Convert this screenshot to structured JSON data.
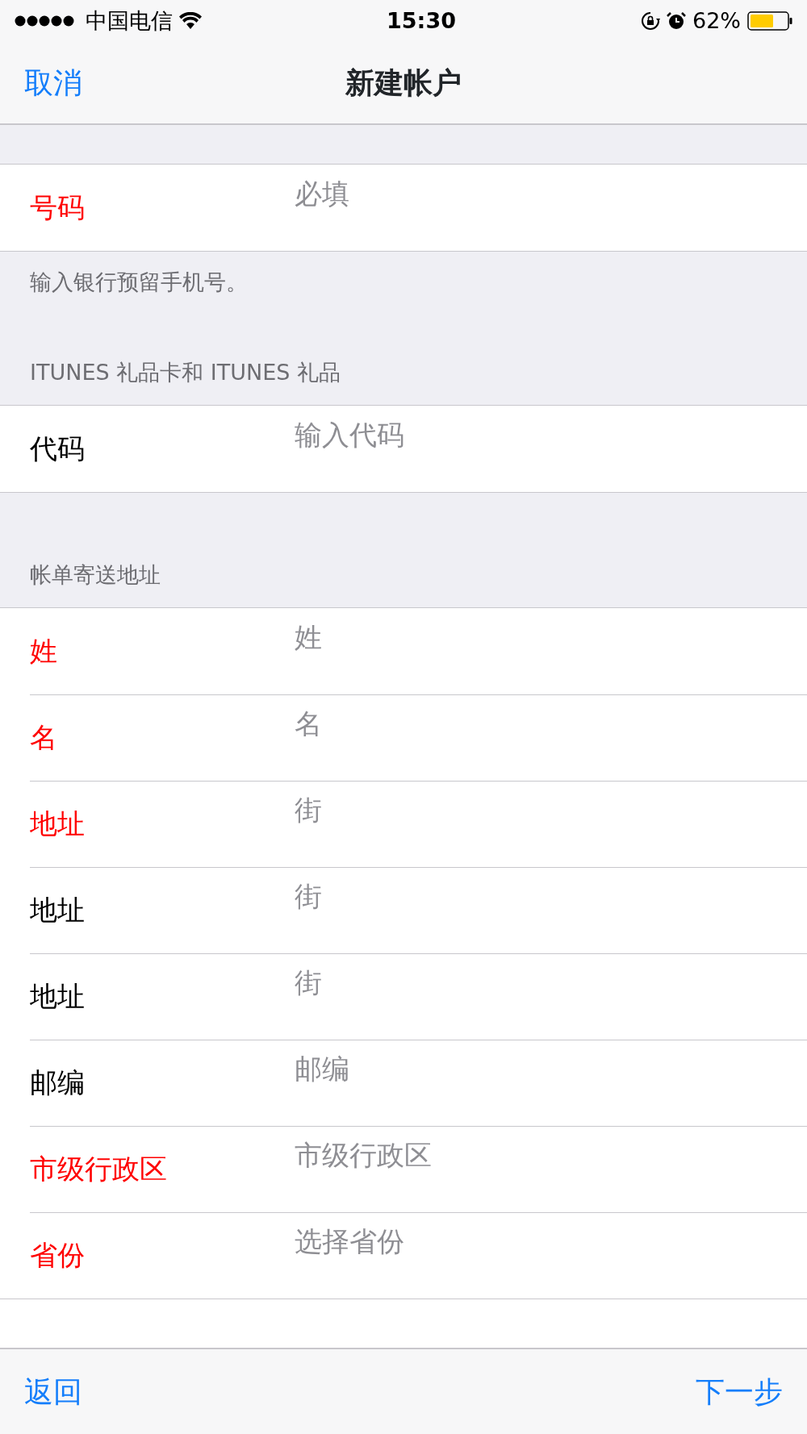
{
  "status_bar": {
    "carrier": "中国电信",
    "time": "15:30",
    "battery": "62%"
  },
  "nav": {
    "cancel": "取消",
    "title": "新建帐户"
  },
  "sections": [
    {
      "rows": [
        {
          "label": "号码",
          "placeholder": "必填",
          "required": true
        }
      ],
      "footer": "输入银行预留手机号。"
    },
    {
      "header": "ITUNES 礼品卡和 ITUNES 礼品",
      "rows": [
        {
          "label": "代码",
          "placeholder": "输入代码",
          "required": false
        }
      ]
    },
    {
      "header": "帐单寄送地址",
      "rows": [
        {
          "label": "姓",
          "placeholder": "姓",
          "required": true
        },
        {
          "label": "名",
          "placeholder": "名",
          "required": true
        },
        {
          "label": "地址",
          "placeholder": "街",
          "required": true
        },
        {
          "label": "地址",
          "placeholder": "街",
          "required": false
        },
        {
          "label": "地址",
          "placeholder": "街",
          "required": false
        },
        {
          "label": "邮编",
          "placeholder": "邮编",
          "required": false
        },
        {
          "label": "市级行政区",
          "placeholder": "市级行政区",
          "required": true
        },
        {
          "label": "省份",
          "placeholder": "选择省份",
          "required": true
        }
      ]
    }
  ],
  "toolbar": {
    "back": "返回",
    "next": "下一步"
  }
}
